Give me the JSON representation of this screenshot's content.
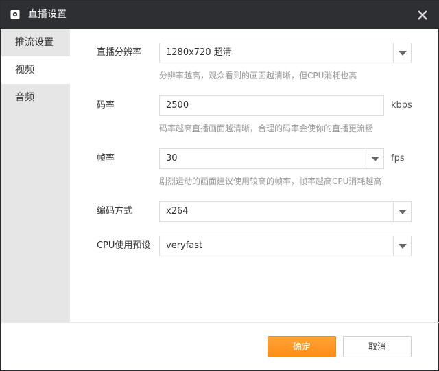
{
  "window": {
    "title": "直播设置"
  },
  "sidebar": {
    "items": [
      {
        "label": "推流设置",
        "active": false
      },
      {
        "label": "视频",
        "active": true
      },
      {
        "label": "音频",
        "active": false
      }
    ]
  },
  "form": {
    "resolution": {
      "label": "直播分辨率",
      "value": "1280x720 超清",
      "hint": "分辨率越高，观众看到的画面越清晰，但CPU消耗也高"
    },
    "bitrate": {
      "label": "码率",
      "value": "2500",
      "unit": "kbps",
      "hint": "码率越高直播画面越清晰，合理的码率会使你的直播更流畅"
    },
    "framerate": {
      "label": "帧率",
      "value": "30",
      "unit": "fps",
      "hint": "剧烈运动的画面建议使用较高的帧率，帧率越高CPU消耗越高"
    },
    "encoder": {
      "label": "编码方式",
      "value": "x264"
    },
    "preset": {
      "label": "CPU使用预设",
      "value": "veryfast"
    }
  },
  "footer": {
    "ok_label": "确定",
    "cancel_label": "取消"
  },
  "colors": {
    "accent": "#ff9a2a",
    "titlebar": "#2e2f33",
    "sidebar": "#e6e6e6"
  }
}
